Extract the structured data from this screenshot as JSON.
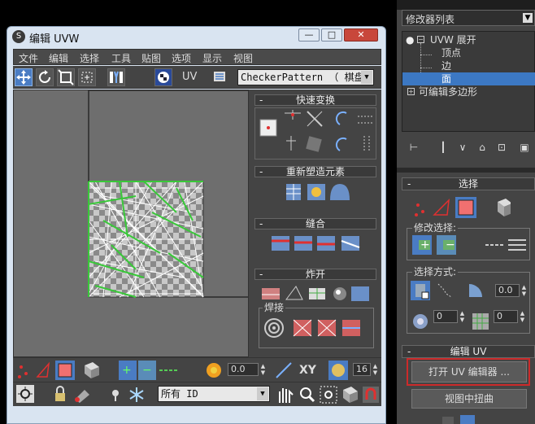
{
  "command_panel": {
    "modifier_list": "修改器列表",
    "stack": {
      "modifier": "UVW 展开",
      "sub_items": [
        "顶点",
        "边",
        "面"
      ],
      "selected_sub": "面",
      "base_object": "可编辑多边形"
    },
    "selection_rollout": {
      "title": "选择",
      "modify_selection_label": "修改选择:",
      "select_by_label": "选择方式:",
      "angle_value": "0.0",
      "spin1_value": "0",
      "spin2_value": "0"
    },
    "edit_uv_rollout": {
      "title": "编辑 UV",
      "open_editor_button": "打开 UV 编辑器 ...",
      "tweak_button": "视图中扭曲"
    }
  },
  "uvw_window": {
    "title": "编辑 UVW",
    "menus": [
      "文件",
      "编辑",
      "选择",
      "工具",
      "贴图",
      "选项",
      "显示",
      "视图"
    ],
    "uv_label": "UV",
    "texture_select": "CheckerPattern （ 棋盘",
    "panels": {
      "quick_transform": "快速变换",
      "reshape": "重新塑造元素",
      "stitch": "缝合",
      "explode": "炸开",
      "weld": "焊接"
    },
    "bottom": {
      "soft_value": "0.0",
      "xy_label": "XY",
      "num_value": "16",
      "id_select": "所有 ID"
    }
  },
  "colors": {
    "accent_blue": "#4a7cc3",
    "highlight_red": "#cc2a2a",
    "uv_green": "#39c839",
    "face_red": "#f07070"
  }
}
